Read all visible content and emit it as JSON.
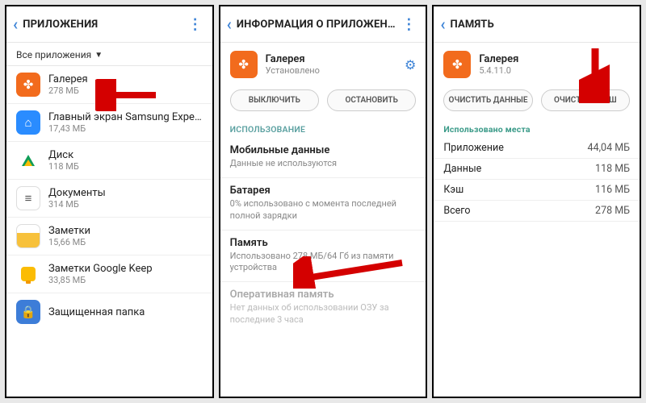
{
  "pane1": {
    "title": "ПРИЛОЖЕНИЯ",
    "filter": "Все приложения",
    "apps": [
      {
        "name": "Галерея",
        "sub": "278 МБ"
      },
      {
        "name": "Главный экран Samsung Experie..",
        "sub": "17,43 МБ"
      },
      {
        "name": "Диск",
        "sub": "118 МБ"
      },
      {
        "name": "Документы",
        "sub": "314 МБ"
      },
      {
        "name": "Заметки",
        "sub": "15,66 МБ"
      },
      {
        "name": "Заметки Google Keep",
        "sub": "33,85 МБ"
      },
      {
        "name": "Защищенная папка",
        "sub": ""
      }
    ]
  },
  "pane2": {
    "title": "ИНФОРМАЦИЯ О ПРИЛОЖЕНИИ",
    "app_name": "Галерея",
    "app_sub": "Установлено",
    "btn_disable": "ВЫКЛЮЧИТЬ",
    "btn_stop": "ОСТАНОВИТЬ",
    "usage_label": "ИСПОЛЬЗОВАНИЕ",
    "rows": [
      {
        "title": "Мобильные данные",
        "sub": "Данные не используются"
      },
      {
        "title": "Батарея",
        "sub": "0% использовано с момента последней полной зарядки"
      },
      {
        "title": "Память",
        "sub": "Использовано 278 МБ/64 Гб из памяти устройства"
      },
      {
        "title": "Оперативная память",
        "sub": "Нет данных об использовании ОЗУ за последние 3 часа"
      }
    ]
  },
  "pane3": {
    "title": "ПАМЯТЬ",
    "app_name": "Галерея",
    "app_sub": "5.4.11.0",
    "btn_clear_data": "ОЧИСТИТЬ ДАННЫЕ",
    "btn_clear_cache": "ОЧИСТИТЬ КЭШ",
    "used_label": "Использовано места",
    "rows": [
      {
        "k": "Приложение",
        "v": "44,04 МБ"
      },
      {
        "k": "Данные",
        "v": "118 МБ"
      },
      {
        "k": "Кэш",
        "v": "116 МБ"
      },
      {
        "k": "Всего",
        "v": "278 МБ"
      }
    ]
  }
}
